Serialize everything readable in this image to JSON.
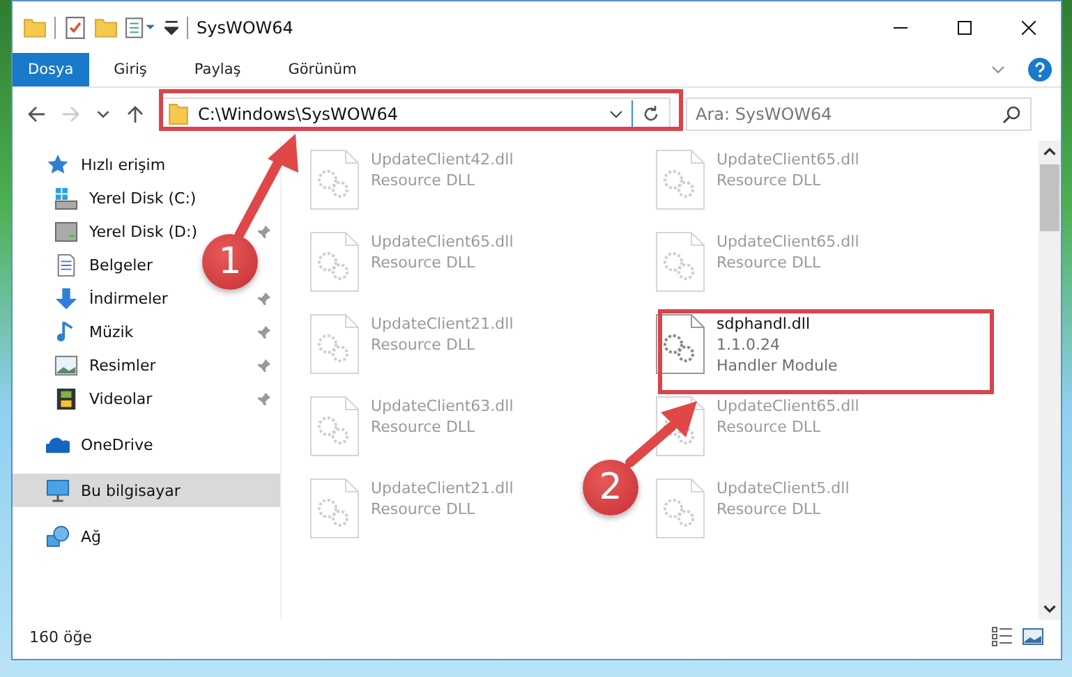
{
  "window": {
    "title": "SysWOW64"
  },
  "ribbon_tabs": [
    {
      "label": "Dosya",
      "selected": true
    },
    {
      "label": "Giriş",
      "selected": false
    },
    {
      "label": "Paylaş",
      "selected": false
    },
    {
      "label": "Görünüm",
      "selected": false
    }
  ],
  "address_bar": {
    "path": "C:\\Windows\\SysWOW64"
  },
  "search": {
    "placeholder": "Ara: SysWOW64"
  },
  "sidebar": {
    "items": [
      {
        "label": "Hızlı erişim",
        "kind": "star",
        "selected": false,
        "children": [
          {
            "label": "Yerel Disk (C:)",
            "kind": "system-drive",
            "pinned": false
          },
          {
            "label": "Yerel Disk (D:)",
            "kind": "drive",
            "pinned": true
          },
          {
            "label": "Belgeler",
            "kind": "documents",
            "pinned": false
          },
          {
            "label": "İndirmeler",
            "kind": "downloads",
            "pinned": true
          },
          {
            "label": "Müzik",
            "kind": "music",
            "pinned": true
          },
          {
            "label": "Resimler",
            "kind": "pictures",
            "pinned": true
          },
          {
            "label": "Videolar",
            "kind": "videos",
            "pinned": true
          }
        ]
      },
      {
        "label": "OneDrive",
        "kind": "cloud",
        "selected": false
      },
      {
        "label": "Bu bilgisayar",
        "kind": "computer",
        "selected": true
      },
      {
        "label": "Ağ",
        "kind": "network",
        "selected": false
      }
    ]
  },
  "files": [
    {
      "name": "UpdateClient42.dll",
      "lines": [
        "Resource DLL"
      ],
      "faded": true
    },
    {
      "name": "UpdateClient65.dll",
      "lines": [
        "Resource DLL"
      ],
      "faded": true
    },
    {
      "name": "UpdateClient65.dll",
      "lines": [
        "Resource DLL"
      ],
      "faded": true
    },
    {
      "name": "UpdateClient65.dll",
      "lines": [
        "Resource DLL"
      ],
      "faded": true
    },
    {
      "name": "UpdateClient21.dll",
      "lines": [
        "Resource DLL"
      ],
      "faded": true
    },
    {
      "name": "sdphandl.dll",
      "lines": [
        "1.1.0.24",
        "Handler Module"
      ],
      "faded": false
    },
    {
      "name": "UpdateClient63.dll",
      "lines": [
        "Resource DLL"
      ],
      "faded": true
    },
    {
      "name": "UpdateClient65.dll",
      "lines": [
        "Resource DLL"
      ],
      "faded": true
    },
    {
      "name": "UpdateClient21.dll",
      "lines": [
        "Resource DLL"
      ],
      "faded": true
    },
    {
      "name": "UpdateClient5.dll",
      "lines": [
        "Resource DLL"
      ],
      "faded": true
    }
  ],
  "status_bar": {
    "item_count": "160 öğe"
  },
  "annotations": [
    {
      "number": "1"
    },
    {
      "number": "2"
    }
  ]
}
